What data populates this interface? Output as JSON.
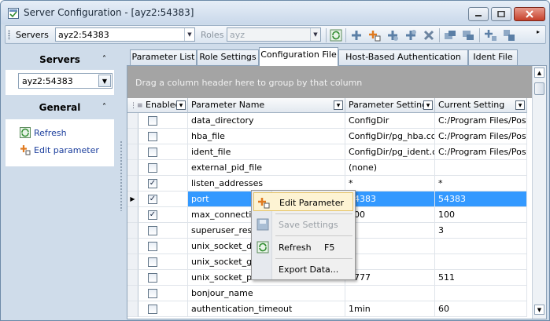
{
  "window": {
    "title": "Server Configuration - [ayz2:54383]"
  },
  "toolbar": {
    "servers_label": "Servers",
    "servers_value": "ayz2:54383",
    "roles_label": "Roles",
    "roles_value": "ayz"
  },
  "sidebar": {
    "servers_header": "Servers",
    "server_value": "ayz2:54383",
    "general_header": "General",
    "links": [
      {
        "label": "Refresh",
        "icon": "refresh-icon"
      },
      {
        "label": "Edit parameter",
        "icon": "edit-parameter-icon"
      }
    ]
  },
  "tabs": [
    {
      "label": "Parameter List",
      "active": false
    },
    {
      "label": "Role Settings",
      "active": false
    },
    {
      "label": "Configuration File",
      "active": true
    },
    {
      "label": "Host-Based Authentication File",
      "active": false
    },
    {
      "label": "Ident File",
      "active": false
    }
  ],
  "grid": {
    "group_hint": "Drag a column header here to group by that column",
    "columns": [
      "Enabled",
      "Parameter Name",
      "Parameter Setting",
      "Current Setting"
    ],
    "rows": [
      {
        "enabled": false,
        "name": "data_directory",
        "setting": "ConfigDir",
        "current": "C:/Program Files/Postg"
      },
      {
        "enabled": false,
        "name": "hba_file",
        "setting": "ConfigDir/pg_hba.conf",
        "current": "C:/Program Files/Postg"
      },
      {
        "enabled": false,
        "name": "ident_file",
        "setting": "ConfigDir/pg_ident.con",
        "current": "C:/Program Files/Postg"
      },
      {
        "enabled": false,
        "name": "external_pid_file",
        "setting": "(none)",
        "current": ""
      },
      {
        "enabled": true,
        "name": "listen_addresses",
        "setting": "*",
        "current": "*"
      },
      {
        "enabled": true,
        "name": "port",
        "setting": "54383",
        "current": "54383",
        "selected": true
      },
      {
        "enabled": true,
        "name": "max_connections",
        "setting": "100",
        "current": "100"
      },
      {
        "enabled": false,
        "name": "superuser_reserved_connections",
        "setting": "",
        "current": "3"
      },
      {
        "enabled": false,
        "name": "unix_socket_directory",
        "setting": "",
        "current": ""
      },
      {
        "enabled": false,
        "name": "unix_socket_group",
        "setting": "",
        "current": ""
      },
      {
        "enabled": false,
        "name": "unix_socket_permissions",
        "setting": "0777",
        "current": "511"
      },
      {
        "enabled": false,
        "name": "bonjour_name",
        "setting": "",
        "current": ""
      },
      {
        "enabled": false,
        "name": "authentication_timeout",
        "setting": "1min",
        "current": "60"
      }
    ]
  },
  "context_menu": {
    "items": [
      {
        "label": "Edit Parameter",
        "shortcut": "",
        "highlighted": true,
        "disabled": false,
        "icon": "edit-parameter-icon"
      },
      {
        "label": "Save Settings",
        "shortcut": "",
        "highlighted": false,
        "disabled": true,
        "icon": "save-icon"
      },
      {
        "label": "Refresh",
        "shortcut": "F5",
        "highlighted": false,
        "disabled": false,
        "icon": "refresh-icon"
      },
      {
        "label": "Export Data...",
        "shortcut": "",
        "highlighted": false,
        "disabled": false,
        "icon": ""
      }
    ]
  }
}
